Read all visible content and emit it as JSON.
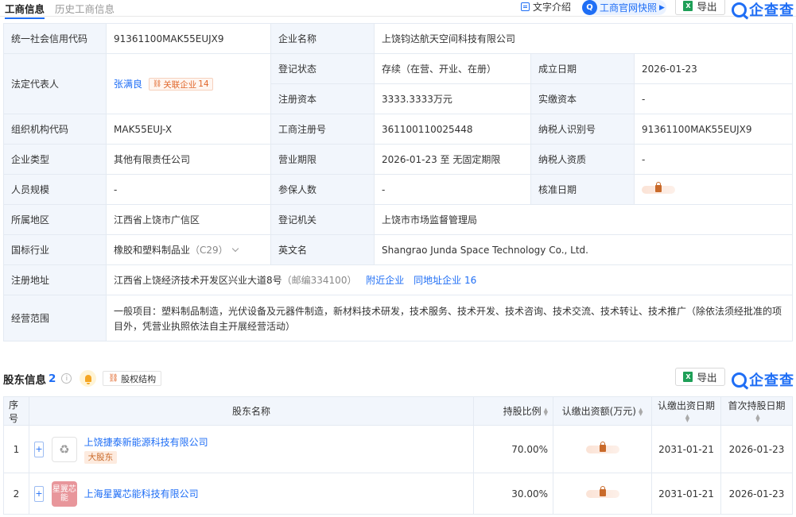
{
  "tabs": [
    {
      "label": "工商信息"
    },
    {
      "label": "历史工商信息"
    }
  ],
  "toolbar": {
    "text_intro": "文字介绍",
    "snapshot": "工商官网快照",
    "export": "导出",
    "brand": "企查查"
  },
  "info": {
    "credit_code_label": "统一社会信用代码",
    "credit_code": "91361100MAK55EUJX9",
    "company_name_label": "企业名称",
    "company_name": "上饶钧达航天空间科技有限公司",
    "legal_rep_label": "法定代表人",
    "legal_rep": "张满良",
    "related_label": "关联企业",
    "related_count": "14",
    "status_label": "登记状态",
    "status": "存续（在营、开业、在册）",
    "founded_label": "成立日期",
    "founded": "2026-01-23",
    "reg_capital_label": "注册资本",
    "reg_capital": "3333.3333万元",
    "paid_capital_label": "实缴资本",
    "paid_capital": "-",
    "org_code_label": "组织机构代码",
    "org_code": "MAK55EUJ-X",
    "reg_no_label": "工商注册号",
    "reg_no": "361100110025448",
    "taxpayer_id_label": "纳税人识别号",
    "taxpayer_id": "91361100MAK55EUJX9",
    "type_label": "企业类型",
    "type": "其他有限责任公司",
    "term_label": "营业期限",
    "term": "2026-01-23 至 无固定期限",
    "taxpayer_qual_label": "纳税人资质",
    "taxpayer_qual": "-",
    "staff_label": "人员规模",
    "staff": "-",
    "insured_label": "参保人数",
    "insured": "-",
    "approved_label": "核准日期",
    "region_label": "所属地区",
    "region": "江西省上饶市广信区",
    "authority_label": "登记机关",
    "authority": "上饶市市场监督管理局",
    "industry_label": "国标行业",
    "industry": "橡胶和塑料制品业",
    "industry_code": "（C29）",
    "english_label": "英文名",
    "english": "Shangrao Junda Space Technology Co., Ltd.",
    "address_label": "注册地址",
    "address": "江西省上饶经济技术开发区兴业大道8号",
    "postcode": "（邮编334100）",
    "nearby": "附近企业",
    "same_addr": "同地址企业",
    "same_addr_count": "16",
    "scope_label": "经营范围",
    "scope": "一般项目：塑料制品制造，光伏设备及元器件制造，新材料技术研发，技术服务、技术开发、技术咨询、技术交流、技术转让、技术推广（除依法须经批准的项目外，凭营业执照依法自主开展经营活动）"
  },
  "shareholders": {
    "title": "股东信息",
    "count": "2",
    "equity_button": "股权结构",
    "export": "导出",
    "brand": "企查查",
    "headers": [
      "序号",
      "股东名称",
      "持股比例",
      "认缴出资额(万元)",
      "认缴出资日期",
      "首次持股日期"
    ],
    "rows": [
      {
        "index": "1",
        "name": "上饶捷泰新能源科技有限公司",
        "tag": "大股东",
        "ratio": "70.00%",
        "subscribed_date": "2031-01-21",
        "first_date": "2026-01-23"
      },
      {
        "index": "2",
        "name": "上海星翼芯能科技有限公司",
        "logo_text": "星翼芯能",
        "ratio": "30.00%",
        "subscribed_date": "2031-01-21",
        "first_date": "2026-01-23"
      }
    ]
  },
  "colors": {
    "accent": "#1f6ef5",
    "label_bg": "#f2f6fc",
    "border": "#e4eaf2",
    "orange": "#e0662a"
  }
}
